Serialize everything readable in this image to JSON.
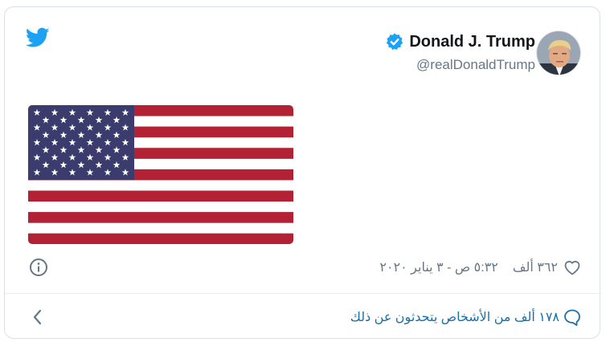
{
  "tweet": {
    "author": {
      "display_name": "Donald J. Trump",
      "handle": "@realDonaldTrump",
      "verified_icon": "verified-badge-icon",
      "avatar": "avatar-photo"
    },
    "media": {
      "type": "image",
      "icon": "us-flag-image"
    },
    "likes": "٣٦٢ ألف",
    "timestamp": "٥:٣٢ ص - ٣ يناير ٢٠٢٠",
    "conversation": "١٧٨ ألف من الأشخاص يتحدثون عن ذلك"
  },
  "icons": {
    "logo": "twitter-bird-icon",
    "info": "info-icon",
    "like": "heart-icon",
    "reply": "chat-bubble-icon",
    "back": "chevron-left-icon"
  },
  "colors": {
    "accent": "#1da1f2",
    "link": "#1b6fa8",
    "muted": "#657786",
    "flag_red": "#b22234",
    "flag_blue": "#3c3b6e"
  }
}
